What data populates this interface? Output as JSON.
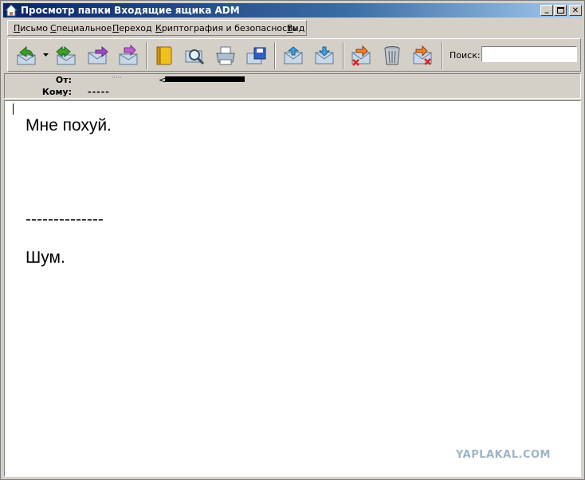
{
  "window": {
    "title": "Просмотр папки Входящие ящика ADM",
    "minimize_glyph": "_",
    "close_glyph": "✕"
  },
  "menu": {
    "items": [
      {
        "label": "Письмо",
        "accel": "П",
        "rest": "исьмо"
      },
      {
        "label": "Специальное",
        "accel": "С",
        "rest": "пециальное"
      },
      {
        "label": "Переход",
        "accel": "П",
        "rest": "ереход"
      },
      {
        "label": "Криптография и безопасность",
        "accel": "К",
        "rest": "риптография и безопасность"
      },
      {
        "label": "Вид",
        "accel": "В",
        "rest": "ид"
      }
    ]
  },
  "toolbar": {
    "icons": [
      "reply-icon",
      "reply-all-icon",
      "forward-icon",
      "redirect-icon",
      "address-book-icon",
      "find-icon",
      "print-icon",
      "save-icon",
      "previous-message-icon",
      "next-message-icon",
      "delete-message-icon",
      "trash-icon",
      "delete-and-next-icon"
    ],
    "search_label": "Поиск:",
    "search_value": ""
  },
  "header": {
    "from_label": "От:",
    "from_name": "·····",
    "from_address_open": "<",
    "to_label": "Кому:",
    "to_value": "-----"
  },
  "body": {
    "lines": [
      "Мне похуй.",
      "--------------",
      "Шум."
    ]
  },
  "watermark": "YAPLAKAL.COM",
  "colors": {
    "titlebar_start": "#0a246a",
    "titlebar_end": "#a6caf0",
    "chrome": "#d4d0c8",
    "body_bg": "#ffffff"
  }
}
